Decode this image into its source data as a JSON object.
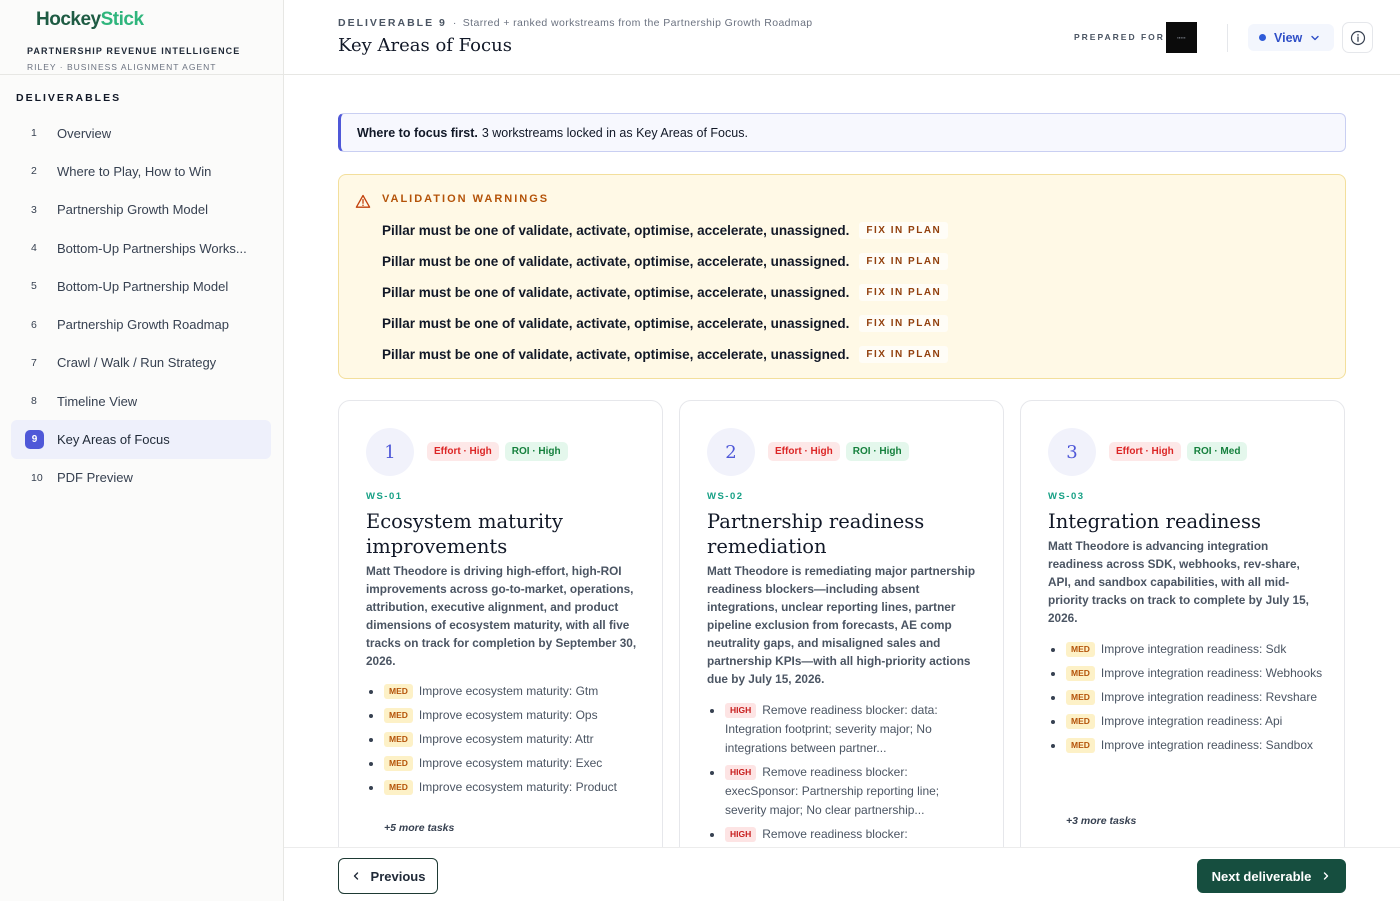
{
  "sidebar": {
    "brand_a": "Hockey",
    "brand_b": "Stick",
    "subtitle": "PARTNERSHIP REVENUE INTELLIGENCE",
    "agent": "RILEY · BUSINESS ALIGNMENT AGENT",
    "section_title": "DELIVERABLES",
    "items": [
      {
        "num": "1",
        "label": "Overview"
      },
      {
        "num": "2",
        "label": "Where to Play, How to Win"
      },
      {
        "num": "3",
        "label": "Partnership Growth Model"
      },
      {
        "num": "4",
        "label": "Bottom-Up Partnerships Works..."
      },
      {
        "num": "5",
        "label": "Bottom-Up Partnership Model"
      },
      {
        "num": "6",
        "label": "Partnership Growth Roadmap"
      },
      {
        "num": "7",
        "label": "Crawl / Walk / Run Strategy"
      },
      {
        "num": "8",
        "label": "Timeline View"
      },
      {
        "num": "9",
        "label": "Key Areas of Focus"
      },
      {
        "num": "10",
        "label": "PDF Preview"
      }
    ],
    "active_index": 8
  },
  "header": {
    "deliverable": "DELIVERABLE 9",
    "separator": "·",
    "crumb_text": "Starred + ranked workstreams from the Partnership Growth Roadmap",
    "title": "Key Areas of Focus",
    "prepared_for": "PREPARED FOR",
    "view_label": "View"
  },
  "banner": {
    "bold": "Where to focus first.",
    "text": "3 workstreams locked in as Key Areas of Focus."
  },
  "warnings": {
    "title": "VALIDATION WARNINGS",
    "items": [
      {
        "message": "Pillar must be one of validate, activate, optimise, accelerate, unassigned.",
        "action": "FIX IN PLAN"
      },
      {
        "message": "Pillar must be one of validate, activate, optimise, accelerate, unassigned.",
        "action": "FIX IN PLAN"
      },
      {
        "message": "Pillar must be one of validate, activate, optimise, accelerate, unassigned.",
        "action": "FIX IN PLAN"
      },
      {
        "message": "Pillar must be one of validate, activate, optimise, accelerate, unassigned.",
        "action": "FIX IN PLAN"
      },
      {
        "message": "Pillar must be one of validate, activate, optimise, accelerate, unassigned.",
        "action": "FIX IN PLAN"
      }
    ]
  },
  "cards": [
    {
      "rank": "1",
      "effort": "Effort · High",
      "roi": "ROI · High",
      "id": "WS-01",
      "title": "Ecosystem maturity improvements",
      "description": "Matt Theodore is driving high-effort, high-ROI improvements across go-to-market, operations, attribution, executive alignment, and product dimensions of ecosystem maturity, with all five tracks on track for completion by September 30, 2026.",
      "tasks": [
        {
          "priority": "MED",
          "text": "Improve ecosystem maturity: Gtm"
        },
        {
          "priority": "MED",
          "text": "Improve ecosystem maturity: Ops"
        },
        {
          "priority": "MED",
          "text": "Improve ecosystem maturity: Attr"
        },
        {
          "priority": "MED",
          "text": "Improve ecosystem maturity: Exec"
        },
        {
          "priority": "MED",
          "text": "Improve ecosystem maturity: Product"
        }
      ],
      "more": "+5 more tasks"
    },
    {
      "rank": "2",
      "effort": "Effort · High",
      "roi": "ROI · High",
      "id": "WS-02",
      "title": "Partnership readiness remediation",
      "description": "Matt Theodore is remediating major partnership readiness blockers—including absent integrations, unclear reporting lines, partner pipeline exclusion from forecasts, AE comp neutrality gaps, and misaligned sales and partnership KPIs—with all high-priority actions due by July 15, 2026.",
      "tasks": [
        {
          "priority": "HIGH",
          "text": "Remove readiness blocker: data: Integration footprint; severity major; No integrations between partner..."
        },
        {
          "priority": "HIGH",
          "text": "Remove readiness blocker: execSponsor: Partnership reporting line; severity major; No clear partnership..."
        },
        {
          "priority": "HIGH",
          "text": "Remove readiness blocker: execSponsor: Partner pipeline in forecast; severity major"
        }
      ],
      "more": ""
    },
    {
      "rank": "3",
      "effort": "Effort · High",
      "roi": "ROI · Med",
      "id": "WS-03",
      "title": "Integration readiness",
      "description": "Matt Theodore is advancing integration readiness across SDK, webhooks, rev-share, API, and sandbox capabilities, with all mid-priority tracks on track to complete by July 15, 2026.",
      "tasks": [
        {
          "priority": "MED",
          "text": "Improve integration readiness: Sdk"
        },
        {
          "priority": "MED",
          "text": "Improve integration readiness: Webhooks"
        },
        {
          "priority": "MED",
          "text": "Improve integration readiness: Revshare"
        },
        {
          "priority": "MED",
          "text": "Improve integration readiness: Api"
        },
        {
          "priority": "MED",
          "text": "Improve integration readiness: Sandbox"
        }
      ],
      "more": "+3 more tasks"
    }
  ],
  "footer": {
    "previous": "Previous",
    "next": "Next deliverable"
  },
  "colors": {
    "accent": "#4f58d8",
    "brand_dark": "#1e5b43",
    "brand_light": "#2fb57c",
    "next_button": "#164e3f",
    "warning_bg": "#fff9e6",
    "warning_text": "#b45309"
  },
  "icons": {
    "warning": "warning-triangle-icon",
    "view_chevron": "chevron-down-icon",
    "info": "info-icon",
    "prev": "chevron-left-icon",
    "next": "chevron-right-icon"
  }
}
